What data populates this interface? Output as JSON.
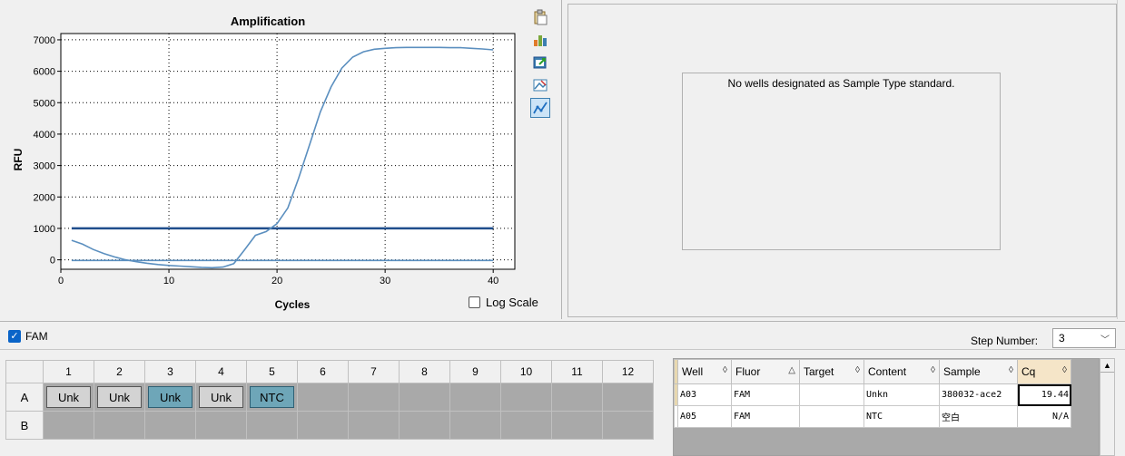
{
  "chart": {
    "title": "Amplification",
    "ylabel": "RFU",
    "xlabel": "Cycles",
    "log_scale_label": "Log Scale",
    "log_scale_checked": false
  },
  "chart_data": {
    "type": "line",
    "title": "Amplification",
    "xlabel": "Cycles",
    "ylabel": "RFU",
    "xlim": [
      0,
      42
    ],
    "ylim": [
      -300,
      7200
    ],
    "x_ticks": [
      0,
      10,
      20,
      30,
      40
    ],
    "y_ticks": [
      0,
      1000,
      2000,
      3000,
      4000,
      5000,
      6000,
      7000
    ],
    "grid": true,
    "threshold": 1000,
    "series": [
      {
        "x": [
          1,
          2,
          3,
          4,
          5,
          6,
          7,
          8,
          9,
          10,
          11,
          12,
          13,
          14,
          15,
          16,
          17,
          18,
          19,
          20,
          21,
          22,
          23,
          24,
          25,
          26,
          27,
          28,
          29,
          30,
          31,
          32,
          33,
          34,
          35,
          36,
          37,
          38,
          39,
          40
        ],
        "y": [
          620,
          500,
          330,
          200,
          90,
          0,
          -60,
          -110,
          -150,
          -180,
          -200,
          -220,
          -240,
          -250,
          -230,
          -120,
          320,
          780,
          900,
          1150,
          1650,
          2600,
          3650,
          4700,
          5500,
          6100,
          6450,
          6620,
          6700,
          6730,
          6750,
          6760,
          6760,
          6760,
          6760,
          6750,
          6750,
          6730,
          6710,
          6680
        ],
        "color": "#5b8fbf"
      },
      {
        "x": [
          1,
          2,
          3,
          4,
          5,
          6,
          7,
          8,
          9,
          10,
          11,
          12,
          13,
          14,
          15,
          16,
          17,
          18,
          19,
          20,
          21,
          22,
          23,
          24,
          25,
          26,
          27,
          28,
          29,
          30,
          31,
          32,
          33,
          34,
          35,
          36,
          37,
          38,
          39,
          40
        ],
        "y": [
          -20,
          -20,
          -20,
          -20,
          -20,
          -20,
          -20,
          -20,
          -20,
          -20,
          -20,
          -20,
          -20,
          -20,
          -20,
          -20,
          -20,
          -20,
          -20,
          -20,
          -20,
          -20,
          -20,
          -20,
          -20,
          -20,
          -20,
          -20,
          -20,
          -20,
          -20,
          -20,
          -20,
          -20,
          -20,
          -20,
          -20,
          -20,
          -20,
          -20
        ],
        "color": "#5b8fbf"
      }
    ]
  },
  "toolbar": {
    "icons": [
      "clipboard-icon",
      "bar-chart-icon",
      "export-icon",
      "image-icon",
      "line-chart-icon"
    ]
  },
  "standard_panel": {
    "message": "No wells designated as Sample Type standard."
  },
  "fluor": {
    "name": "FAM",
    "checked": true
  },
  "step": {
    "label": "Step Number:",
    "value": "3"
  },
  "plate": {
    "columns": [
      "1",
      "2",
      "3",
      "4",
      "5",
      "6",
      "7",
      "8",
      "9",
      "10",
      "11",
      "12"
    ],
    "rows": [
      "A",
      "B"
    ],
    "wells": {
      "A": [
        "Unk",
        "Unk",
        "Unk",
        "Unk",
        "NTC",
        "",
        "",
        "",
        "",
        "",
        "",
        ""
      ],
      "B": [
        "",
        "",
        "",
        "",
        "",
        "",
        "",
        "",
        "",
        "",
        "",
        ""
      ]
    }
  },
  "table": {
    "headers": [
      "Well",
      "Fluor",
      "Target",
      "Content",
      "Sample",
      "Cq"
    ],
    "rows": [
      {
        "well": "A03",
        "fluor": "FAM",
        "target": "",
        "content": "Unkn",
        "sample": "380032-ace2",
        "cq": "19.44"
      },
      {
        "well": "A05",
        "fluor": "FAM",
        "target": "",
        "content": "NTC",
        "sample": "空白",
        "cq": "N/A"
      }
    ]
  },
  "colors": {
    "curve": "#5b8fbf",
    "threshold": "#1f4e8c",
    "selected_well": "#6ea6b8",
    "unk_well": "#d3d3d3",
    "empty_well": "#a9a9a9"
  }
}
